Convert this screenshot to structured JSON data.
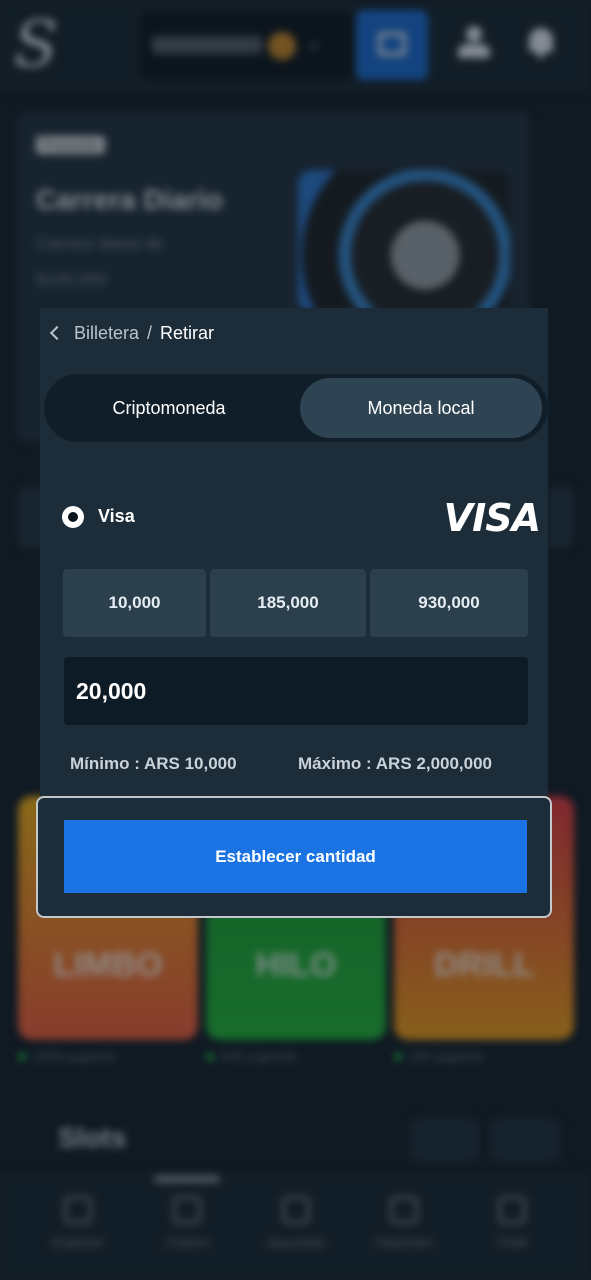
{
  "background": {
    "logo": "S",
    "promo": {
      "tag": "Promoción",
      "title": "Carrera Diario",
      "subtitle_line1": "Carrera diaria de",
      "subtitle_line2": "$100,000"
    },
    "games": [
      {
        "name": "LIMBO",
        "playing": "1829 jugando"
      },
      {
        "name": "HILO",
        "playing": "546 jugando"
      },
      {
        "name": "DRILL",
        "playing": "105 jugando"
      }
    ],
    "slots_title": "Slots",
    "bottom_nav": [
      "Explorar",
      "Casino",
      "Apuestas",
      "Deportes",
      "Chat"
    ]
  },
  "modal": {
    "breadcrumb": {
      "parent": "Billetera",
      "separator": "/",
      "current": "Retirar"
    },
    "tabs": [
      {
        "label": "Criptomoneda",
        "active": false
      },
      {
        "label": "Moneda local",
        "active": true
      }
    ],
    "method": {
      "label": "Visa",
      "brand": "VISA",
      "selected": true
    },
    "preset_amounts": [
      "10,000",
      "185,000",
      "930,000"
    ],
    "amount_input": {
      "value": "20,000"
    },
    "limits": {
      "min": "Mínimo : ARS 10,000",
      "max": "Máximo : ARS 2,000,000"
    },
    "cta_label": "Establecer cantidad"
  },
  "colors": {
    "accent": "#1b73e3",
    "background": "#16232e",
    "panel": "#1c2d39"
  }
}
